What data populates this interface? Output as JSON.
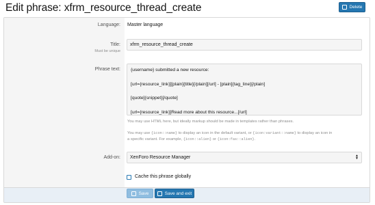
{
  "header": {
    "title": "Edit phrase: xfrm_resource_thread_create",
    "delete_label": "Delete"
  },
  "form": {
    "language": {
      "label": "Language:",
      "value": "Master language"
    },
    "title": {
      "label": "Title:",
      "hint": "Must be unique",
      "value": "xfrm_resource_thread_create"
    },
    "phrase_text": {
      "label": "Phrase text:",
      "lines": [
        "{username} submitted a new resource:",
        "[url={resource_link}][plain]{title}[/plain][/url] - [plain]{tag_line}[/plain]",
        "[quote]{snippet}[/quote]",
        "[url={resource_link}]Read more about this resource...[/url]"
      ],
      "explain_1": "You may use HTML here, but ideally markup should be made in templates rather than phrases.",
      "explain_2a_pre": "You may use ",
      "explain_2a_code1": "{icon::name}",
      "explain_2a_mid": " to display an icon in the default variant, or ",
      "explain_2a_code2": "{icon:variant::name}",
      "explain_2a_post": " to display an icon in",
      "explain_2b_pre": "a specific variant. For example, ",
      "explain_2b_code1": "{icon::alien}",
      "explain_2b_mid": " or ",
      "explain_2b_code2": "{icon:fas::alien}",
      "explain_2b_post": "."
    },
    "addon": {
      "label": "Add-on:",
      "value": "XenForo Resource Manager"
    },
    "cache_globally": {
      "label": "Cache this phrase globally",
      "checked": false
    }
  },
  "footer": {
    "save_label": "Save",
    "save_exit_label": "Save and exit"
  },
  "colors": {
    "primary": "#2577b1",
    "primary_disabled": "#8fbde0",
    "footer_bg": "#e8eff6",
    "label_col_bg": "#f5f5f5"
  }
}
